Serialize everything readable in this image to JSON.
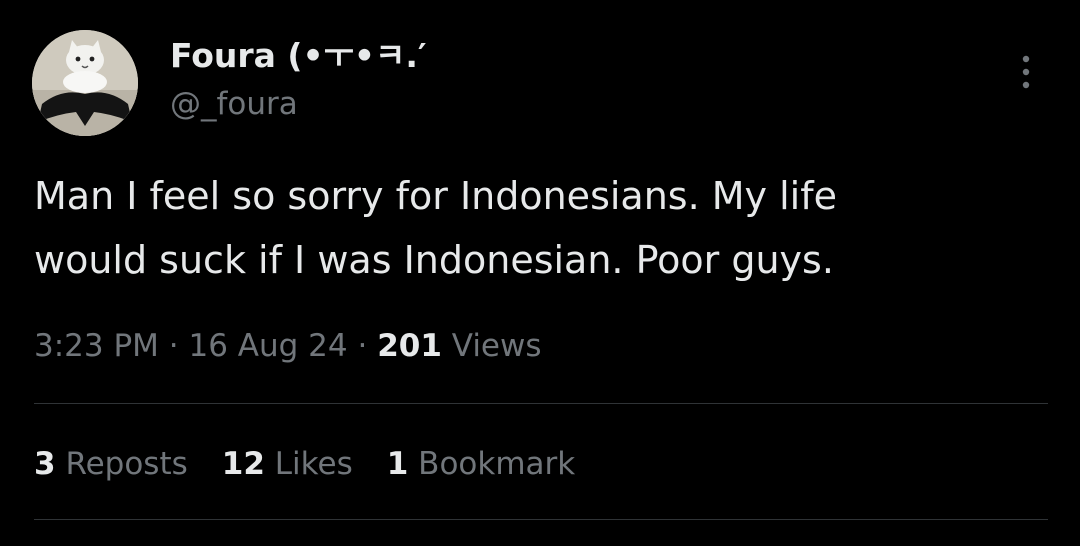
{
  "tweet": {
    "author": {
      "display_name": "Foura (•ㅜ•ㅋ.′",
      "handle": "@_foura"
    },
    "text_lines": [
      "Man I feel so sorry for Indonesians. My life",
      "would suck if I was Indonesian. Poor guys."
    ],
    "time": "3:23 PM",
    "date": "16 Aug 24",
    "separator": "·",
    "views_count": "201",
    "views_label": "Views",
    "stats": {
      "reposts_count": "3",
      "reposts_label": "Reposts",
      "likes_count": "12",
      "likes_label": "Likes",
      "bookmarks_count": "1",
      "bookmarks_label": "Bookmark"
    }
  },
  "icons": {
    "more": "more-vertical-icon"
  },
  "colors": {
    "background": "#000000",
    "primary_text": "#e7e9ea",
    "secondary_text": "#71767b",
    "divider": "#2f3336"
  }
}
